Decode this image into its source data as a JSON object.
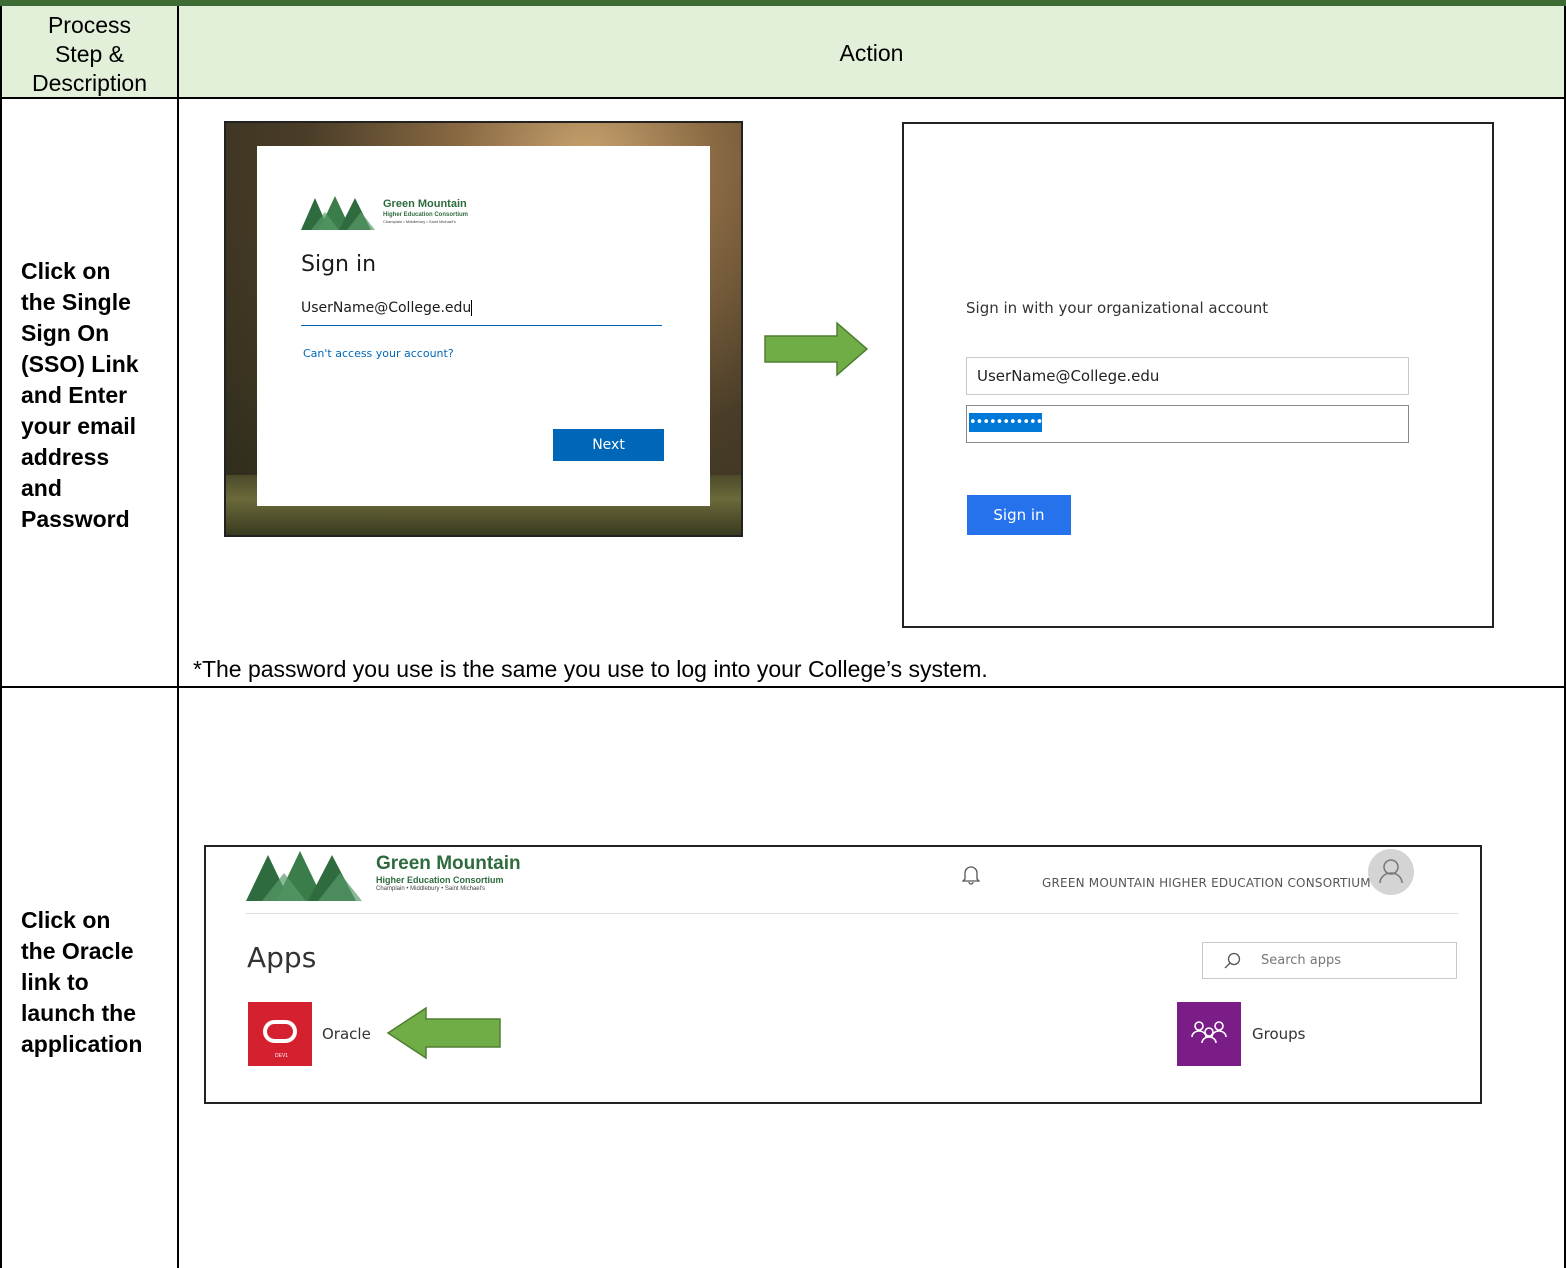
{
  "table": {
    "header": {
      "col1": [
        "Process",
        "Step &",
        "Description"
      ],
      "col2": "Action"
    },
    "rows": [
      {
        "step": [
          "Click on",
          "the Single",
          "Sign On",
          "(SSO) Link",
          "and Enter",
          "your email",
          "address",
          "and",
          "Password"
        ],
        "note": "*The password you use is the same you use to log into your College’s system."
      },
      {
        "step": [
          "Click on",
          "the Oracle",
          "link to",
          "launch the",
          "application"
        ]
      }
    ]
  },
  "shot1": {
    "logo": {
      "name": "Green Mountain",
      "tagline": "Higher Education Consortium",
      "members": "Champlain • Middlebury • Saint Michael's"
    },
    "title": "Sign in",
    "email_value": "UserName@College.edu",
    "cant_access": "Can't access your account?",
    "next_label": "Next"
  },
  "shot2": {
    "heading": "Sign in with your organizational account",
    "username_value": "UserName@College.edu",
    "password_value": "•••••••••••",
    "signin_label": "Sign in"
  },
  "shot3": {
    "logo": {
      "name": "Green Mountain",
      "tagline": "Higher Education Consortium",
      "members": "Champlain • Middlebury • Saint Michael's"
    },
    "org_name": "GREEN MOUNTAIN HIGHER EDUCATION CONSORTIUM",
    "apps_title": "Apps",
    "search_placeholder": "Search apps",
    "apps": [
      {
        "label": "Oracle",
        "icon": "oracle-icon",
        "tile_badge": "DEV1"
      },
      {
        "label": "Groups",
        "icon": "groups-icon"
      }
    ]
  },
  "colors": {
    "header_bg": "#e2efd9",
    "top_bar": "#3e6b33",
    "arrow_green": "#70ad47",
    "ms_blue": "#0067b8",
    "oracle_red": "#d5202f",
    "groups_purple": "#7a1d86"
  }
}
